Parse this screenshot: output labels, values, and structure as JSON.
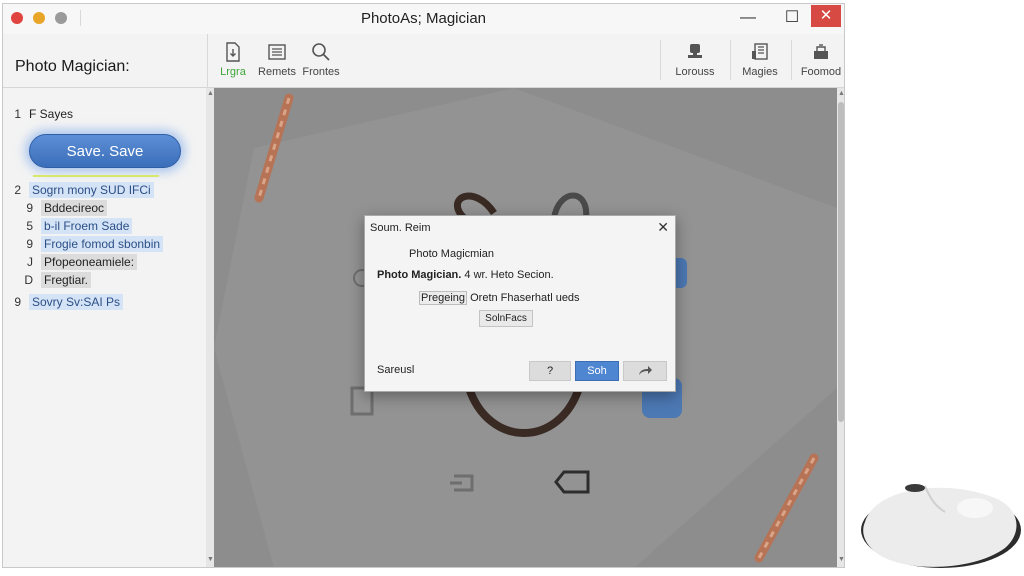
{
  "window": {
    "title": "PhotoAs; Magician",
    "controls": {
      "minimize": "—",
      "maximize": "☐",
      "close": "✕"
    }
  },
  "app_name": "Photo Magician:",
  "toolbar": {
    "left": [
      {
        "label": "Lrgra",
        "icon": "import-file-icon"
      },
      {
        "label": "Remets",
        "icon": "list-icon"
      },
      {
        "label": "Frontes",
        "icon": "search-icon"
      }
    ],
    "right": [
      {
        "label": "Lorouss",
        "icon": "stamp-icon"
      },
      {
        "label": "Magies",
        "icon": "building-icon"
      },
      {
        "label": "Foomod",
        "icon": "tray-icon"
      }
    ]
  },
  "sidebar": {
    "section1": {
      "num": "1",
      "label": "F Sayes"
    },
    "save_button": "Save. Save",
    "section2": {
      "num": "2",
      "label": "Sogrn mony SUD IFCi"
    },
    "items": [
      {
        "num": "9",
        "label": "Bddecireoc"
      },
      {
        "num": "5",
        "label": "b-il Froem Sade"
      },
      {
        "num": "9",
        "label": "Frogie fomod sbonbin"
      },
      {
        "num": "J",
        "label": "Pfopeoneamiele:"
      },
      {
        "num": "D",
        "label": "Fregtiar."
      }
    ],
    "section3": {
      "num": "9",
      "label": "Sovry Sv:SAI Ps"
    }
  },
  "dialog": {
    "title": "Soum. Reim",
    "close": "✕",
    "line1": "Photo Magicmian",
    "line2_bold": "Photo Magician.",
    "line2_rest": " 4 wr. Heto Secion.",
    "line3_part1": "Pregeing",
    "line3_part2": " Oretn Fhaserhatl ueds",
    "small_button": "SolnFacs",
    "footer_label": "Sareusl",
    "btn_help": "?",
    "btn_ok": "Soh",
    "btn_share_icon": "share-arrow-icon"
  },
  "colors": {
    "accent_blue": "#4f86d2",
    "active_green": "#3fa63a",
    "close_red": "#d64a43",
    "canvas_gray": "#8f8f8f"
  }
}
